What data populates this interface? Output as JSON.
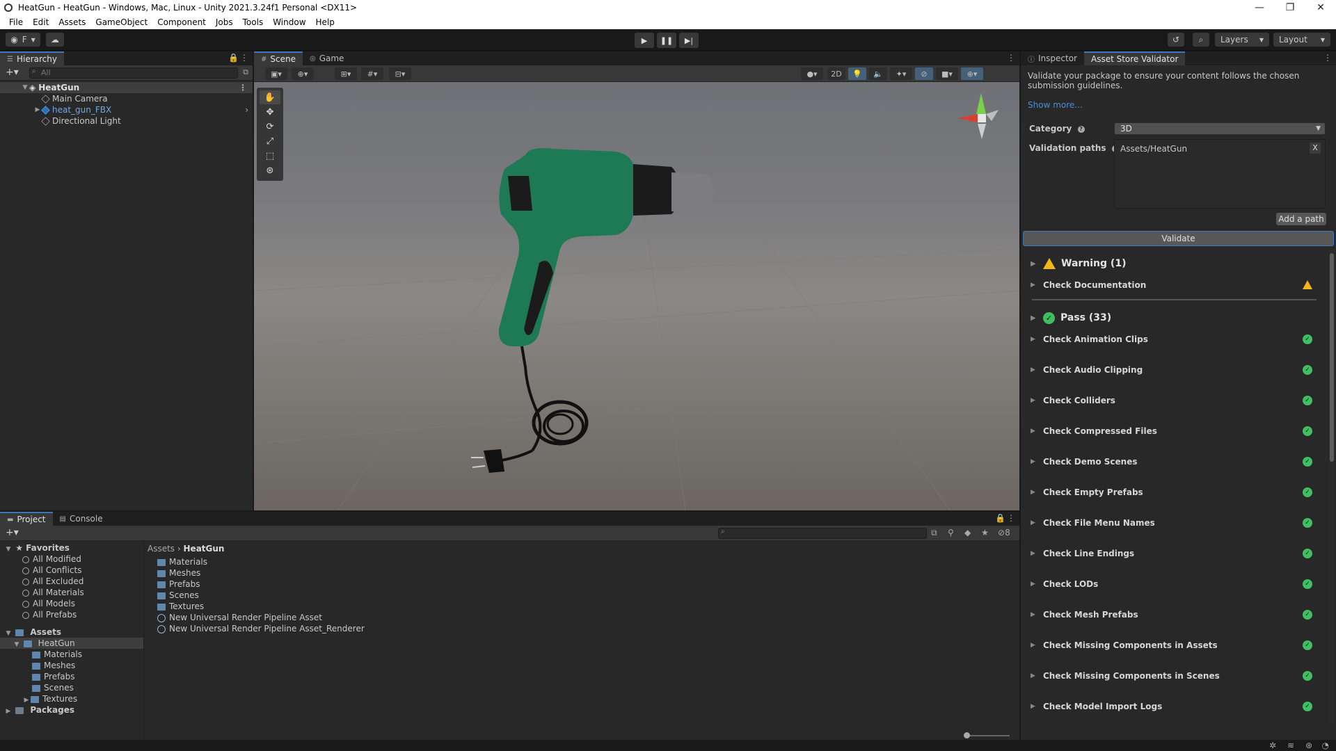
{
  "window": {
    "title": "HeatGun - HeatGun - Windows, Mac, Linux - Unity 2021.3.24f1 Personal <DX11>",
    "controls": [
      "—",
      "❐",
      "✕"
    ]
  },
  "menu": [
    "File",
    "Edit",
    "Assets",
    "GameObject",
    "Component",
    "Jobs",
    "Tools",
    "Window",
    "Help"
  ],
  "toolbar": {
    "account_label": "F",
    "layers_label": "Layers",
    "layout_label": "Layout"
  },
  "hierarchy": {
    "tab": "Hierarchy",
    "search_placeholder": "All",
    "root": "HeatGun",
    "items": [
      "Main Camera",
      "heat_gun_FBX",
      "Directional Light"
    ]
  },
  "scene": {
    "tabs": [
      "Scene",
      "Game"
    ],
    "mode_2d": "2D"
  },
  "inspector": {
    "tabs": [
      "Inspector",
      "Asset Store Validator"
    ],
    "description": "Validate your package to ensure your content follows the chosen submission guidelines.",
    "show_more": "Show more...",
    "category_label": "Category",
    "category_value": "3D",
    "validation_paths_label": "Validation paths",
    "path": "Assets/HeatGun",
    "remove_label": "X",
    "add_path_label": "Add a path",
    "validate_label": "Validate",
    "warning_header": "Warning (1)",
    "warnings": [
      "Check Documentation"
    ],
    "pass_header": "Pass (33)",
    "passes": [
      "Check Animation Clips",
      "Check Audio Clipping",
      "Check Colliders",
      "Check Compressed Files",
      "Check Demo Scenes",
      "Check Empty Prefabs",
      "Check File Menu Names",
      "Check Line Endings",
      "Check LODs",
      "Check Mesh Prefabs",
      "Check Missing Components in Assets",
      "Check Missing Components in Scenes",
      "Check Model Import Logs"
    ]
  },
  "project": {
    "tabs": [
      "Project",
      "Console"
    ],
    "hidden_count": "8",
    "favorites_label": "Favorites",
    "favorites": [
      "All Modified",
      "All Conflicts",
      "All Excluded",
      "All Materials",
      "All Models",
      "All Prefabs"
    ],
    "assets_label": "Assets",
    "heatgun_label": "HeatGun",
    "heatgun_children": [
      "Materials",
      "Meshes",
      "Prefabs",
      "Scenes",
      "Textures"
    ],
    "packages_label": "Packages",
    "breadcrumb": [
      "Assets",
      "HeatGun"
    ],
    "contents_folders": [
      "Materials",
      "Meshes",
      "Prefabs",
      "Scenes",
      "Textures"
    ],
    "contents_assets": [
      "New Universal Render Pipeline Asset",
      "New Universal Render Pipeline Asset_Renderer"
    ]
  },
  "colors": {
    "accent": "#3a79bb",
    "pass": "#3fbf62",
    "warning": "#f2b51a",
    "link": "#4a8fd6"
  }
}
